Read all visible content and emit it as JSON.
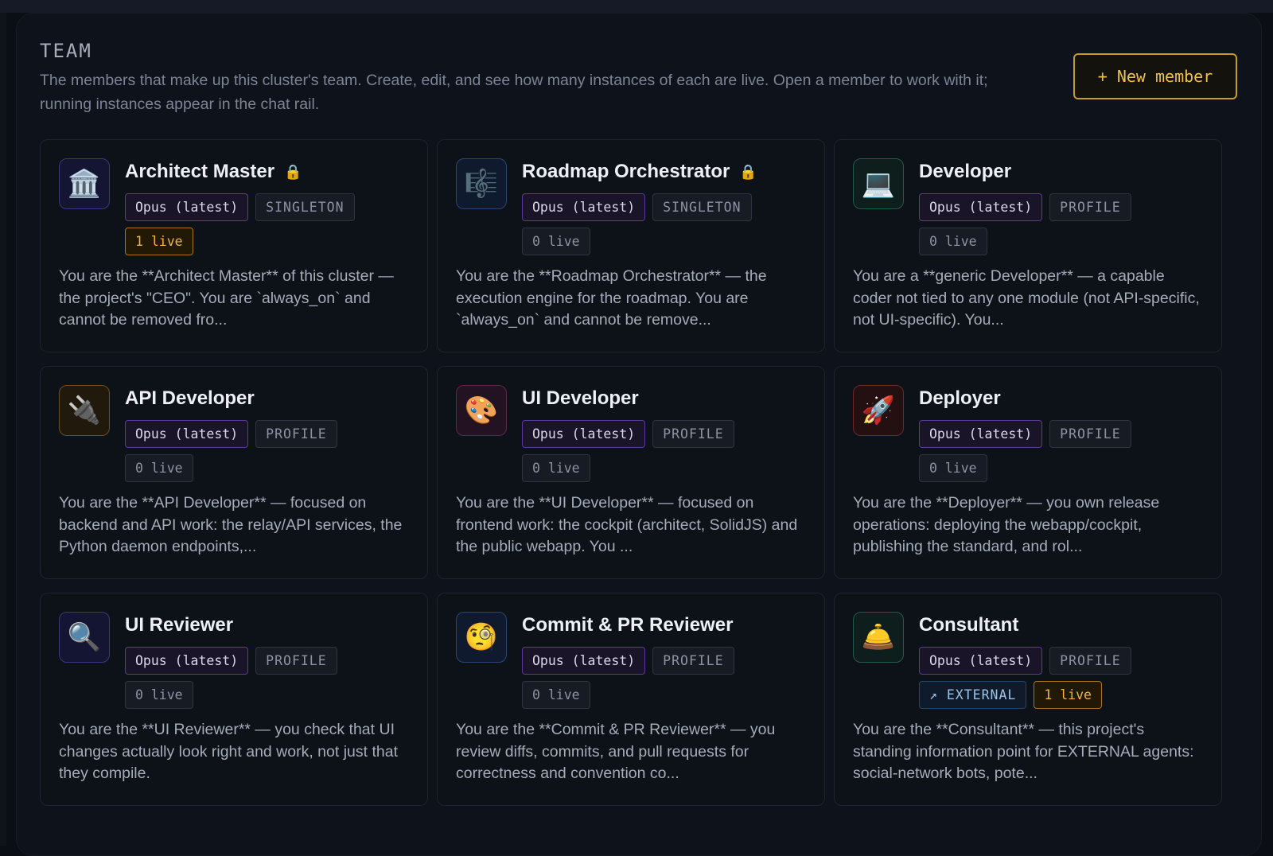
{
  "header": {
    "title": "TEAM",
    "description": "The members that make up this cluster's team. Create, edit, and see how many instances of each are live. Open a member to work with it; running instances appear in the chat rail.",
    "new_member_label": "+ New member"
  },
  "members": [
    {
      "name": "Architect Master",
      "icon": "classical-building-icon",
      "glyph": "🏛️",
      "locked": true,
      "model": "Opus (latest)",
      "kind": "SINGLETON",
      "live": "1 live",
      "external": "",
      "description": "You are the **Architect Master** of this cluster — the project's \"CEO\". You are `always_on` and cannot be removed fro..."
    },
    {
      "name": "Roadmap Orchestrator",
      "icon": "musical-score-icon",
      "glyph": "🎼",
      "locked": true,
      "model": "Opus (latest)",
      "kind": "SINGLETON",
      "live": "0 live",
      "external": "",
      "description": "You are the **Roadmap Orchestrator** — the execution engine for the roadmap. You are `always_on` and cannot be remove..."
    },
    {
      "name": "Developer",
      "icon": "laptop-icon",
      "glyph": "💻",
      "locked": false,
      "model": "Opus (latest)",
      "kind": "PROFILE",
      "live": "0 live",
      "external": "",
      "description": "You are a **generic Developer** — a capable coder not tied to any one module (not API-specific, not UI-specific). You..."
    },
    {
      "name": "API Developer",
      "icon": "electric-plug-icon",
      "glyph": "🔌",
      "locked": false,
      "model": "Opus (latest)",
      "kind": "PROFILE",
      "live": "0 live",
      "external": "",
      "description": "You are the **API Developer** — focused on backend and API work: the relay/API services, the Python daemon endpoints,..."
    },
    {
      "name": "UI Developer",
      "icon": "artist-palette-icon",
      "glyph": "🎨",
      "locked": false,
      "model": "Opus (latest)",
      "kind": "PROFILE",
      "live": "0 live",
      "external": "",
      "description": "You are the **UI Developer** — focused on frontend work: the cockpit (architect, SolidJS) and the public webapp. You ..."
    },
    {
      "name": "Deployer",
      "icon": "rocket-icon",
      "glyph": "🚀",
      "locked": false,
      "model": "Opus (latest)",
      "kind": "PROFILE",
      "live": "0 live",
      "external": "",
      "description": "You are the **Deployer** — you own release operations: deploying the webapp/cockpit, publishing the standard, and rol..."
    },
    {
      "name": "UI Reviewer",
      "icon": "magnifying-glass-icon",
      "glyph": "🔍",
      "locked": false,
      "model": "Opus (latest)",
      "kind": "PROFILE",
      "live": "0 live",
      "external": "",
      "description": "You are the **UI Reviewer** — you check that UI changes actually look right and work, not just that they compile."
    },
    {
      "name": "Commit & PR Reviewer",
      "icon": "monocle-face-icon",
      "glyph": "🧐",
      "locked": false,
      "model": "Opus (latest)",
      "kind": "PROFILE",
      "live": "0 live",
      "external": "",
      "description": "You are the **Commit & PR Reviewer** — you review diffs, commits, and pull requests for correctness and convention co..."
    },
    {
      "name": "Consultant",
      "icon": "bellhop-bell-icon",
      "glyph": "🛎️",
      "locked": false,
      "model": "Opus (latest)",
      "kind": "PROFILE",
      "live": "1 live",
      "external": "↗ EXTERNAL",
      "description": "You are the **Consultant** — this project's standing information point for EXTERNAL agents: social-network bots, pote..."
    }
  ],
  "colors": {
    "accent_gold": "#f0c04a",
    "model_tag_border": "#5a3a9a",
    "live_active": "#f0b540",
    "external_tag": "#9cc2e6",
    "icon_tints": [
      "#3a3a7a",
      "#2c4670",
      "#235a4a",
      "#6a5020",
      "#5a2a4a",
      "#6a2a2a",
      "#3a3a7a",
      "#2c4670",
      "#235a4a"
    ]
  }
}
